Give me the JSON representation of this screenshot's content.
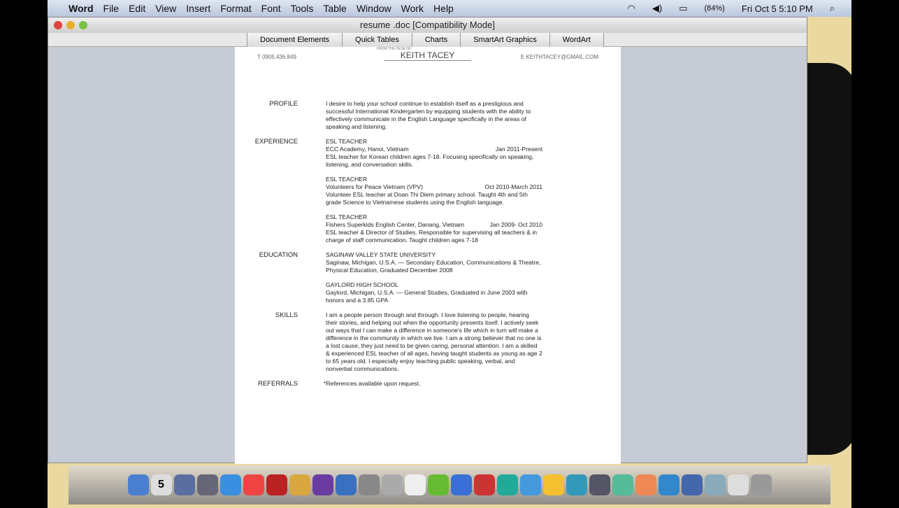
{
  "menubar": {
    "apple": "",
    "app": "Word",
    "items": [
      "File",
      "Edit",
      "View",
      "Insert",
      "Format",
      "Font",
      "Tools",
      "Table",
      "Window",
      "Work",
      "Help"
    ],
    "battery": "(84%)",
    "clock": "Fri Oct 5  5:10 PM"
  },
  "window": {
    "title": "resume .doc [Compatibility Mode]",
    "tabs": [
      "Document Elements",
      "Quick Tables",
      "Charts",
      "SmartArt Graphics",
      "WordArt"
    ]
  },
  "doc": {
    "phone": "T 0905.436.849",
    "from": "FROM THE DESK OF",
    "name": "KEITH TACEY",
    "email": "E KEITHTACEY@GMAIL.COM",
    "profile": {
      "label": "PROFILE",
      "text": "I desire to help your school continue to establish itself as a prestigious and successful International Kindergarten by equipping students with the ability to effectively communicate in the English Language specifically  in the areas of speaking and listening."
    },
    "experience": {
      "label": "EXPERIENCE",
      "jobs": [
        {
          "title": "ESL TEACHER",
          "org": "ECC Academy, Hanoi, Vietnam",
          "dates": "Jan 2011-Present",
          "desc": "ESL teacher for Korean children ages 7-18. Focusing specifically on speaking, listening, and conversation skills."
        },
        {
          "title": "ESL TEACHER",
          "org": "Volunteers for Peace Vietnam (VPV)",
          "dates": "Oct 2010-March 2011",
          "desc": "Volunteer ESL teacher at Doan Thi Diem primary school. Taught 4th and 5th grade Science to Vietnamese students using the English language."
        },
        {
          "title": "ESL TEACHER",
          "org": "Fishers Superkids English Center, Danang, Vietnam",
          "dates": "Jan 2009- Oct 2010",
          "desc": "ESL teacher & Director of Studies. Responsible for supervising all teachers & in charge of staff communication. Taught children ages 7-18"
        }
      ]
    },
    "education": {
      "label": "EDUCATION",
      "schools": [
        {
          "name": "SAGINAW VALLEY STATE UNIVERSITY",
          "desc": "Saginaw, Michigan, U.S.A. — Secondary Education, Communications & Theatre, Physical Education, Graduated December 2008"
        },
        {
          "name": "GAYLORD HIGH SCHOOL",
          "desc": "Gaylord, Michigan, U.S.A. — General Studies, Graduated in June 2003 with honors and a 3.85 GPA"
        }
      ]
    },
    "skills": {
      "label": "SKILLS",
      "text": "I am a people person through and through. I love listening to people, hearing their stories, and helping out when the opportunity presents itself. I actively seek out ways that I can make a difference in someone's life which in turn will make a difference in the community in which we live. I am a strong believer that no one is a lost cause, they just need to be given caring, personal attention. I am a skilled & experienced ESL teacher of all ages, having taught students as young as age 2 to 65 years old. I especially enjoy teaching public speaking, verbal, and nonverbal communications."
    },
    "referrals": {
      "label": "REFERRALS",
      "text": "*References available upon request."
    }
  },
  "dock": {
    "calendar_day": "5",
    "colors": [
      "#4a7fd0",
      "#ddd",
      "#5a6fa0",
      "#667",
      "#3a8fe0",
      "#e44",
      "#b22",
      "#d9a640",
      "#6a3ba0",
      "#3a70c0",
      "#888",
      "#aaa",
      "#eee",
      "#6b3",
      "#3a6fd8",
      "#c33",
      "#2a9",
      "#49d",
      "#f5c030",
      "#39b",
      "#556",
      "#5b9",
      "#e85",
      "#38c",
      "#46a",
      "#8ab",
      "#ddd",
      "#999"
    ]
  }
}
